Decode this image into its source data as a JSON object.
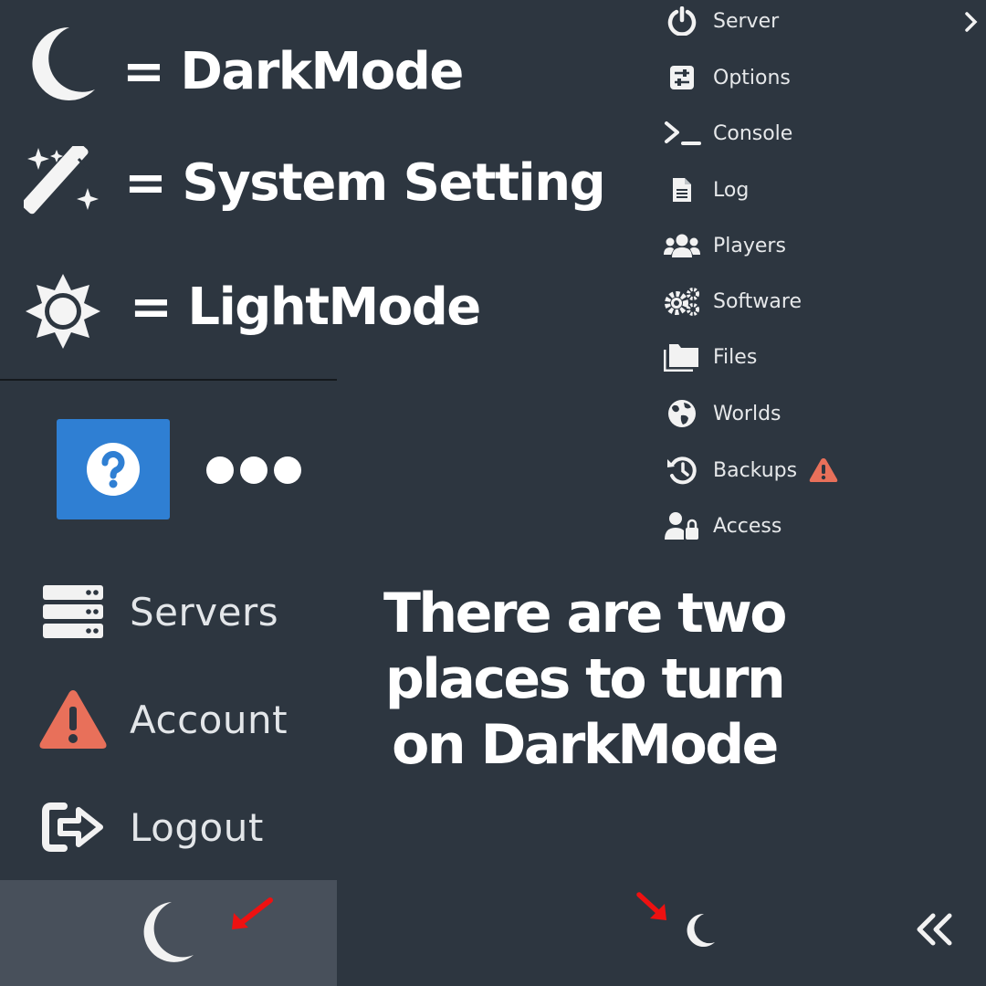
{
  "legend": {
    "dark_mode": "= DarkMode",
    "system_setting": "= System Setting",
    "light_mode": "= LightMode"
  },
  "left_nav": {
    "items": [
      {
        "label": "Servers",
        "icon": "server-stack-icon"
      },
      {
        "label": "Account",
        "icon": "warning-icon"
      },
      {
        "label": "Logout",
        "icon": "logout-icon"
      }
    ]
  },
  "server_menu": {
    "items": [
      {
        "label": "Server",
        "icon": "power-icon"
      },
      {
        "label": "Options",
        "icon": "sliders-icon"
      },
      {
        "label": "Console",
        "icon": "terminal-icon"
      },
      {
        "label": "Log",
        "icon": "file-icon"
      },
      {
        "label": "Players",
        "icon": "users-icon"
      },
      {
        "label": "Software",
        "icon": "gears-icon"
      },
      {
        "label": "Files",
        "icon": "folder-icon"
      },
      {
        "label": "Worlds",
        "icon": "globe-icon"
      },
      {
        "label": "Backups",
        "icon": "history-icon",
        "badge": "warning-icon"
      },
      {
        "label": "Access",
        "icon": "user-lock-icon"
      }
    ]
  },
  "caption": "There are two places to turn on DarkMode",
  "colors": {
    "background": "#2d3640",
    "help_blue": "#2f7fd3",
    "warning": "#e8705a",
    "arrow_red": "#ee1111",
    "bottom_bar": "#48505b"
  }
}
